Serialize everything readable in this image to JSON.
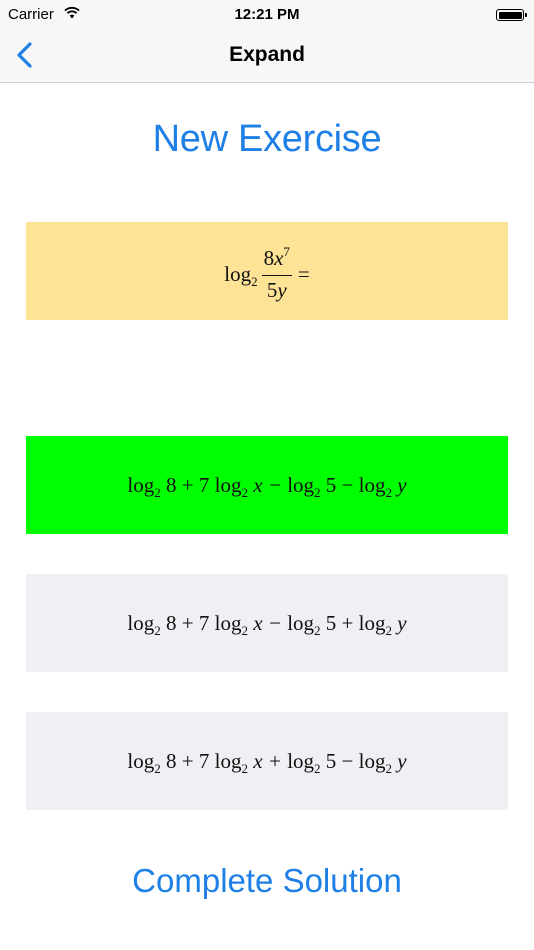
{
  "status_bar": {
    "carrier": "Carrier",
    "time": "12:21 PM"
  },
  "nav": {
    "title": "Expand",
    "back_icon": "chevron-left-icon"
  },
  "new_exercise_label": "New Exercise",
  "question": {
    "log": "log",
    "base": "2",
    "num_coef": "8",
    "num_var": "x",
    "num_exp": "7",
    "den_coef": "5",
    "den_var": "y",
    "equals": "="
  },
  "answers": [
    {
      "state": "correct",
      "bg": "#00ff00",
      "text": "log₂ 8 + 7 log₂ x − log₂ 5 − log₂ y",
      "parts": {
        "t1": "8 + 7",
        "t2": "x −",
        "t3": "5 −",
        "t4": "y"
      }
    },
    {
      "state": "neutral",
      "bg": "#efeff4",
      "text": "log₂ 8 + 7 log₂ x − log₂ 5 + log₂ y",
      "parts": {
        "t1": "8 + 7",
        "t2": "x −",
        "t3": "5 +",
        "t4": "y"
      }
    },
    {
      "state": "neutral",
      "bg": "#efeff4",
      "text": "log₂ 8 + 7 log₂ x + log₂ 5 − log₂ y",
      "parts": {
        "t1": "8 + 7",
        "t2": "x +",
        "t3": "5 −",
        "t4": "y"
      }
    }
  ],
  "complete_solution_label": "Complete Solution",
  "colors": {
    "accent": "#1e7fe6",
    "question_bg": "#fde396",
    "correct": "#00ff00",
    "option_bg": "#efeff4"
  }
}
